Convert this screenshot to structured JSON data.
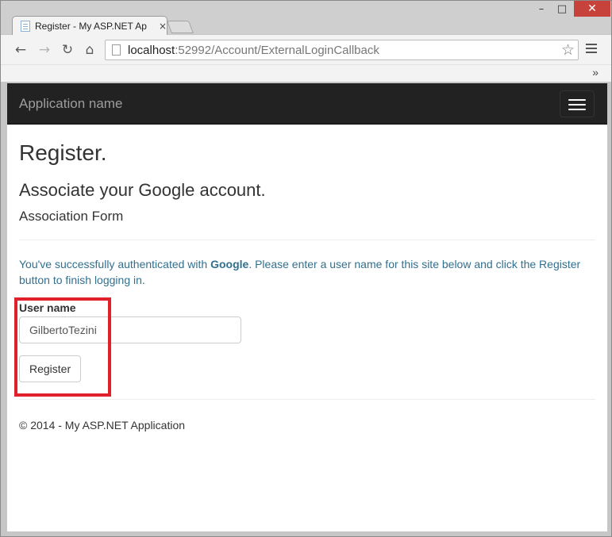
{
  "browser": {
    "tab_title": "Register - My ASP.NET Ap",
    "tab_close": "×",
    "url_host": "localhost",
    "url_path": ":52992/Account/ExternalLoginCallback",
    "bookmarks_overflow": "»",
    "window_controls": {
      "minimize": "–",
      "maximize": "□",
      "close": "✕"
    }
  },
  "navbar": {
    "brand": "Application name"
  },
  "page": {
    "title": "Register.",
    "subtitle": "Associate your Google account.",
    "form_heading": "Association Form",
    "info_prefix": "You've successfully authenticated with ",
    "info_provider": "Google",
    "info_suffix": ". Please enter a user name for this site below and click the Register button to finish logging in.",
    "username_label": "User name",
    "username_value": "GilbertoTezini",
    "register_label": "Register",
    "footer": "© 2014 - My ASP.NET Application"
  },
  "colors": {
    "navbar_bg": "#222222",
    "info_text": "#31708f",
    "highlight_border": "#e0202b"
  },
  "icons": [
    "back-icon",
    "forward-icon",
    "reload-icon",
    "home-icon",
    "page-icon",
    "star-icon",
    "menu-icon",
    "hamburger-icon",
    "tab-page-icon"
  ]
}
